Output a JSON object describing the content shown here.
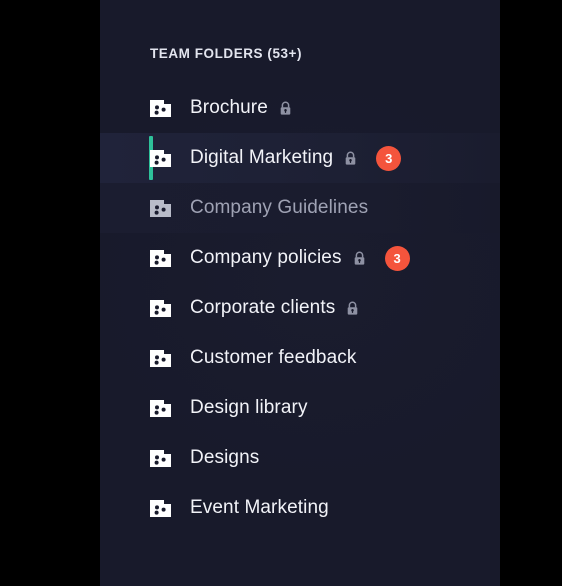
{
  "panel": {
    "background_color": "#181a2b",
    "accent_color": "#2ec19a",
    "badge_color": "#f4543c",
    "section_header": "TEAM FOLDERS (53+)"
  },
  "folders": [
    {
      "label": "Brochure",
      "locked": true,
      "badge": null,
      "state": "normal"
    },
    {
      "label": "Digital Marketing",
      "locked": true,
      "badge": "3",
      "state": "active"
    },
    {
      "label": "Company Guidelines",
      "locked": false,
      "badge": null,
      "state": "dimmed"
    },
    {
      "label": "Company policies",
      "locked": true,
      "badge": "3",
      "state": "normal"
    },
    {
      "label": "Corporate clients",
      "locked": true,
      "badge": null,
      "state": "normal"
    },
    {
      "label": "Customer feedback",
      "locked": false,
      "badge": null,
      "state": "normal"
    },
    {
      "label": "Design library",
      "locked": false,
      "badge": null,
      "state": "normal"
    },
    {
      "label": "Designs",
      "locked": false,
      "badge": null,
      "state": "normal"
    },
    {
      "label": "Event Marketing",
      "locked": false,
      "badge": null,
      "state": "normal"
    }
  ],
  "icons": {
    "folder": "folder-icon",
    "lock": "lock-icon"
  }
}
